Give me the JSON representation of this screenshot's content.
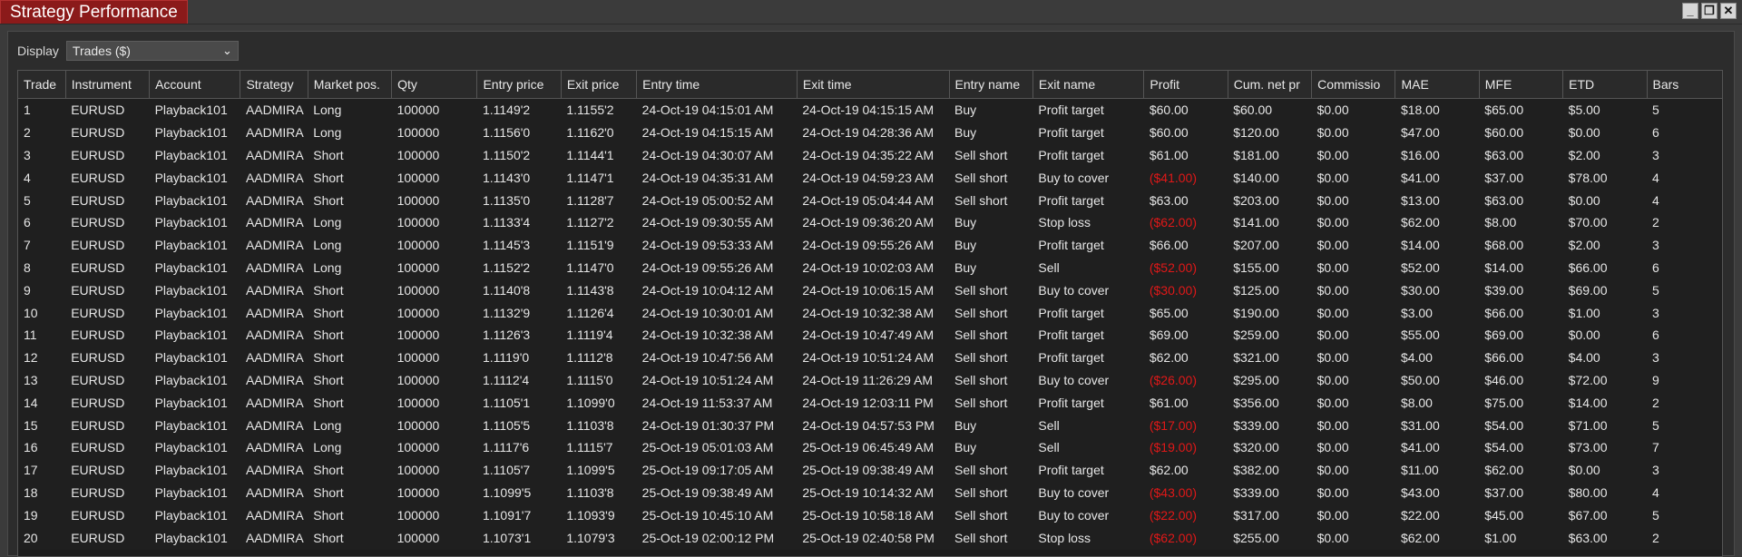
{
  "window": {
    "title": "Strategy Performance",
    "buttons": {
      "minimize": "_",
      "restore": "❐",
      "close": "✕"
    }
  },
  "display": {
    "label": "Display",
    "selected": "Trades ($)"
  },
  "columns": [
    "Trade",
    "Instrument",
    "Account",
    "Strategy",
    "Market pos.",
    "Qty",
    "Entry price",
    "Exit price",
    "Entry time",
    "Exit time",
    "Entry name",
    "Exit name",
    "Profit",
    "Cum. net pr",
    "Commissio",
    "MAE",
    "MFE",
    "ETD",
    "Bars"
  ],
  "rows": [
    [
      "1",
      "EURUSD",
      "Playback101",
      "AADMIRA",
      "Long",
      "100000",
      "1.1149'2",
      "1.1155'2",
      "24-Oct-19 04:15:01 AM",
      "24-Oct-19 04:15:15 AM",
      "Buy",
      "Profit target",
      "$60.00",
      "$60.00",
      "$0.00",
      "$18.00",
      "$65.00",
      "$5.00",
      "5"
    ],
    [
      "2",
      "EURUSD",
      "Playback101",
      "AADMIRA",
      "Long",
      "100000",
      "1.1156'0",
      "1.1162'0",
      "24-Oct-19 04:15:15 AM",
      "24-Oct-19 04:28:36 AM",
      "Buy",
      "Profit target",
      "$60.00",
      "$120.00",
      "$0.00",
      "$47.00",
      "$60.00",
      "$0.00",
      "6"
    ],
    [
      "3",
      "EURUSD",
      "Playback101",
      "AADMIRA",
      "Short",
      "100000",
      "1.1150'2",
      "1.1144'1",
      "24-Oct-19 04:30:07 AM",
      "24-Oct-19 04:35:22 AM",
      "Sell short",
      "Profit target",
      "$61.00",
      "$181.00",
      "$0.00",
      "$16.00",
      "$63.00",
      "$2.00",
      "3"
    ],
    [
      "4",
      "EURUSD",
      "Playback101",
      "AADMIRA",
      "Short",
      "100000",
      "1.1143'0",
      "1.1147'1",
      "24-Oct-19 04:35:31 AM",
      "24-Oct-19 04:59:23 AM",
      "Sell short",
      "Buy to cover",
      "($41.00)",
      "$140.00",
      "$0.00",
      "$41.00",
      "$37.00",
      "$78.00",
      "4"
    ],
    [
      "5",
      "EURUSD",
      "Playback101",
      "AADMIRA",
      "Short",
      "100000",
      "1.1135'0",
      "1.1128'7",
      "24-Oct-19 05:00:52 AM",
      "24-Oct-19 05:04:44 AM",
      "Sell short",
      "Profit target",
      "$63.00",
      "$203.00",
      "$0.00",
      "$13.00",
      "$63.00",
      "$0.00",
      "4"
    ],
    [
      "6",
      "EURUSD",
      "Playback101",
      "AADMIRA",
      "Long",
      "100000",
      "1.1133'4",
      "1.1127'2",
      "24-Oct-19 09:30:55 AM",
      "24-Oct-19 09:36:20 AM",
      "Buy",
      "Stop loss",
      "($62.00)",
      "$141.00",
      "$0.00",
      "$62.00",
      "$8.00",
      "$70.00",
      "2"
    ],
    [
      "7",
      "EURUSD",
      "Playback101",
      "AADMIRA",
      "Long",
      "100000",
      "1.1145'3",
      "1.1151'9",
      "24-Oct-19 09:53:33 AM",
      "24-Oct-19 09:55:26 AM",
      "Buy",
      "Profit target",
      "$66.00",
      "$207.00",
      "$0.00",
      "$14.00",
      "$68.00",
      "$2.00",
      "3"
    ],
    [
      "8",
      "EURUSD",
      "Playback101",
      "AADMIRA",
      "Long",
      "100000",
      "1.1152'2",
      "1.1147'0",
      "24-Oct-19 09:55:26 AM",
      "24-Oct-19 10:02:03 AM",
      "Buy",
      "Sell",
      "($52.00)",
      "$155.00",
      "$0.00",
      "$52.00",
      "$14.00",
      "$66.00",
      "6"
    ],
    [
      "9",
      "EURUSD",
      "Playback101",
      "AADMIRA",
      "Short",
      "100000",
      "1.1140'8",
      "1.1143'8",
      "24-Oct-19 10:04:12 AM",
      "24-Oct-19 10:06:15 AM",
      "Sell short",
      "Buy to cover",
      "($30.00)",
      "$125.00",
      "$0.00",
      "$30.00",
      "$39.00",
      "$69.00",
      "5"
    ],
    [
      "10",
      "EURUSD",
      "Playback101",
      "AADMIRA",
      "Short",
      "100000",
      "1.1132'9",
      "1.1126'4",
      "24-Oct-19 10:30:01 AM",
      "24-Oct-19 10:32:38 AM",
      "Sell short",
      "Profit target",
      "$65.00",
      "$190.00",
      "$0.00",
      "$3.00",
      "$66.00",
      "$1.00",
      "3"
    ],
    [
      "11",
      "EURUSD",
      "Playback101",
      "AADMIRA",
      "Short",
      "100000",
      "1.1126'3",
      "1.1119'4",
      "24-Oct-19 10:32:38 AM",
      "24-Oct-19 10:47:49 AM",
      "Sell short",
      "Profit target",
      "$69.00",
      "$259.00",
      "$0.00",
      "$55.00",
      "$69.00",
      "$0.00",
      "6"
    ],
    [
      "12",
      "EURUSD",
      "Playback101",
      "AADMIRA",
      "Short",
      "100000",
      "1.1119'0",
      "1.1112'8",
      "24-Oct-19 10:47:56 AM",
      "24-Oct-19 10:51:24 AM",
      "Sell short",
      "Profit target",
      "$62.00",
      "$321.00",
      "$0.00",
      "$4.00",
      "$66.00",
      "$4.00",
      "3"
    ],
    [
      "13",
      "EURUSD",
      "Playback101",
      "AADMIRA",
      "Short",
      "100000",
      "1.1112'4",
      "1.1115'0",
      "24-Oct-19 10:51:24 AM",
      "24-Oct-19 11:26:29 AM",
      "Sell short",
      "Buy to cover",
      "($26.00)",
      "$295.00",
      "$0.00",
      "$50.00",
      "$46.00",
      "$72.00",
      "9"
    ],
    [
      "14",
      "EURUSD",
      "Playback101",
      "AADMIRA",
      "Short",
      "100000",
      "1.1105'1",
      "1.1099'0",
      "24-Oct-19 11:53:37 AM",
      "24-Oct-19 12:03:11 PM",
      "Sell short",
      "Profit target",
      "$61.00",
      "$356.00",
      "$0.00",
      "$8.00",
      "$75.00",
      "$14.00",
      "2"
    ],
    [
      "15",
      "EURUSD",
      "Playback101",
      "AADMIRA",
      "Long",
      "100000",
      "1.1105'5",
      "1.1103'8",
      "24-Oct-19 01:30:37 PM",
      "24-Oct-19 04:57:53 PM",
      "Buy",
      "Sell",
      "($17.00)",
      "$339.00",
      "$0.00",
      "$31.00",
      "$54.00",
      "$71.00",
      "5"
    ],
    [
      "16",
      "EURUSD",
      "Playback101",
      "AADMIRA",
      "Long",
      "100000",
      "1.1117'6",
      "1.1115'7",
      "25-Oct-19 05:01:03 AM",
      "25-Oct-19 06:45:49 AM",
      "Buy",
      "Sell",
      "($19.00)",
      "$320.00",
      "$0.00",
      "$41.00",
      "$54.00",
      "$73.00",
      "7"
    ],
    [
      "17",
      "EURUSD",
      "Playback101",
      "AADMIRA",
      "Short",
      "100000",
      "1.1105'7",
      "1.1099'5",
      "25-Oct-19 09:17:05 AM",
      "25-Oct-19 09:38:49 AM",
      "Sell short",
      "Profit target",
      "$62.00",
      "$382.00",
      "$0.00",
      "$11.00",
      "$62.00",
      "$0.00",
      "3"
    ],
    [
      "18",
      "EURUSD",
      "Playback101",
      "AADMIRA",
      "Short",
      "100000",
      "1.1099'5",
      "1.1103'8",
      "25-Oct-19 09:38:49 AM",
      "25-Oct-19 10:14:32 AM",
      "Sell short",
      "Buy to cover",
      "($43.00)",
      "$339.00",
      "$0.00",
      "$43.00",
      "$37.00",
      "$80.00",
      "4"
    ],
    [
      "19",
      "EURUSD",
      "Playback101",
      "AADMIRA",
      "Short",
      "100000",
      "1.1091'7",
      "1.1093'9",
      "25-Oct-19 10:45:10 AM",
      "25-Oct-19 10:58:18 AM",
      "Sell short",
      "Buy to cover",
      "($22.00)",
      "$317.00",
      "$0.00",
      "$22.00",
      "$45.00",
      "$67.00",
      "5"
    ],
    [
      "20",
      "EURUSD",
      "Playback101",
      "AADMIRA",
      "Short",
      "100000",
      "1.1073'1",
      "1.1079'3",
      "25-Oct-19 02:00:12 PM",
      "25-Oct-19 02:40:58 PM",
      "Sell short",
      "Stop loss",
      "($62.00)",
      "$255.00",
      "$0.00",
      "$62.00",
      "$1.00",
      "$63.00",
      "2"
    ]
  ],
  "colors": {
    "negative": "#e01818",
    "title_tab": "#8b1a1a"
  }
}
